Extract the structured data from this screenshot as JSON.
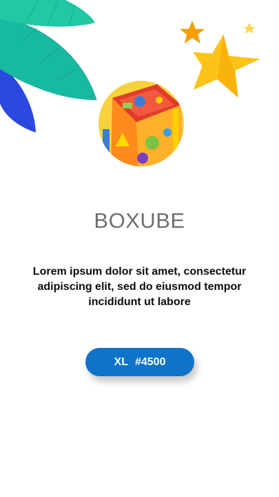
{
  "product": {
    "title": "BOXUBE",
    "description": "Lorem ipsum dolor sit amet, consectetur adipiscing elit, sed do eiusmod tempor incididunt ut labore",
    "size": "XL",
    "price": "#4500",
    "image_icon": "toy-cube-image"
  },
  "colors": {
    "button": "#0f73c9",
    "title": "#6f6f6f",
    "star": "#fcc419",
    "star_orange": "#f59f00",
    "leaf_teal": "#1fbfa6",
    "leaf_blue": "#2b59e6"
  }
}
